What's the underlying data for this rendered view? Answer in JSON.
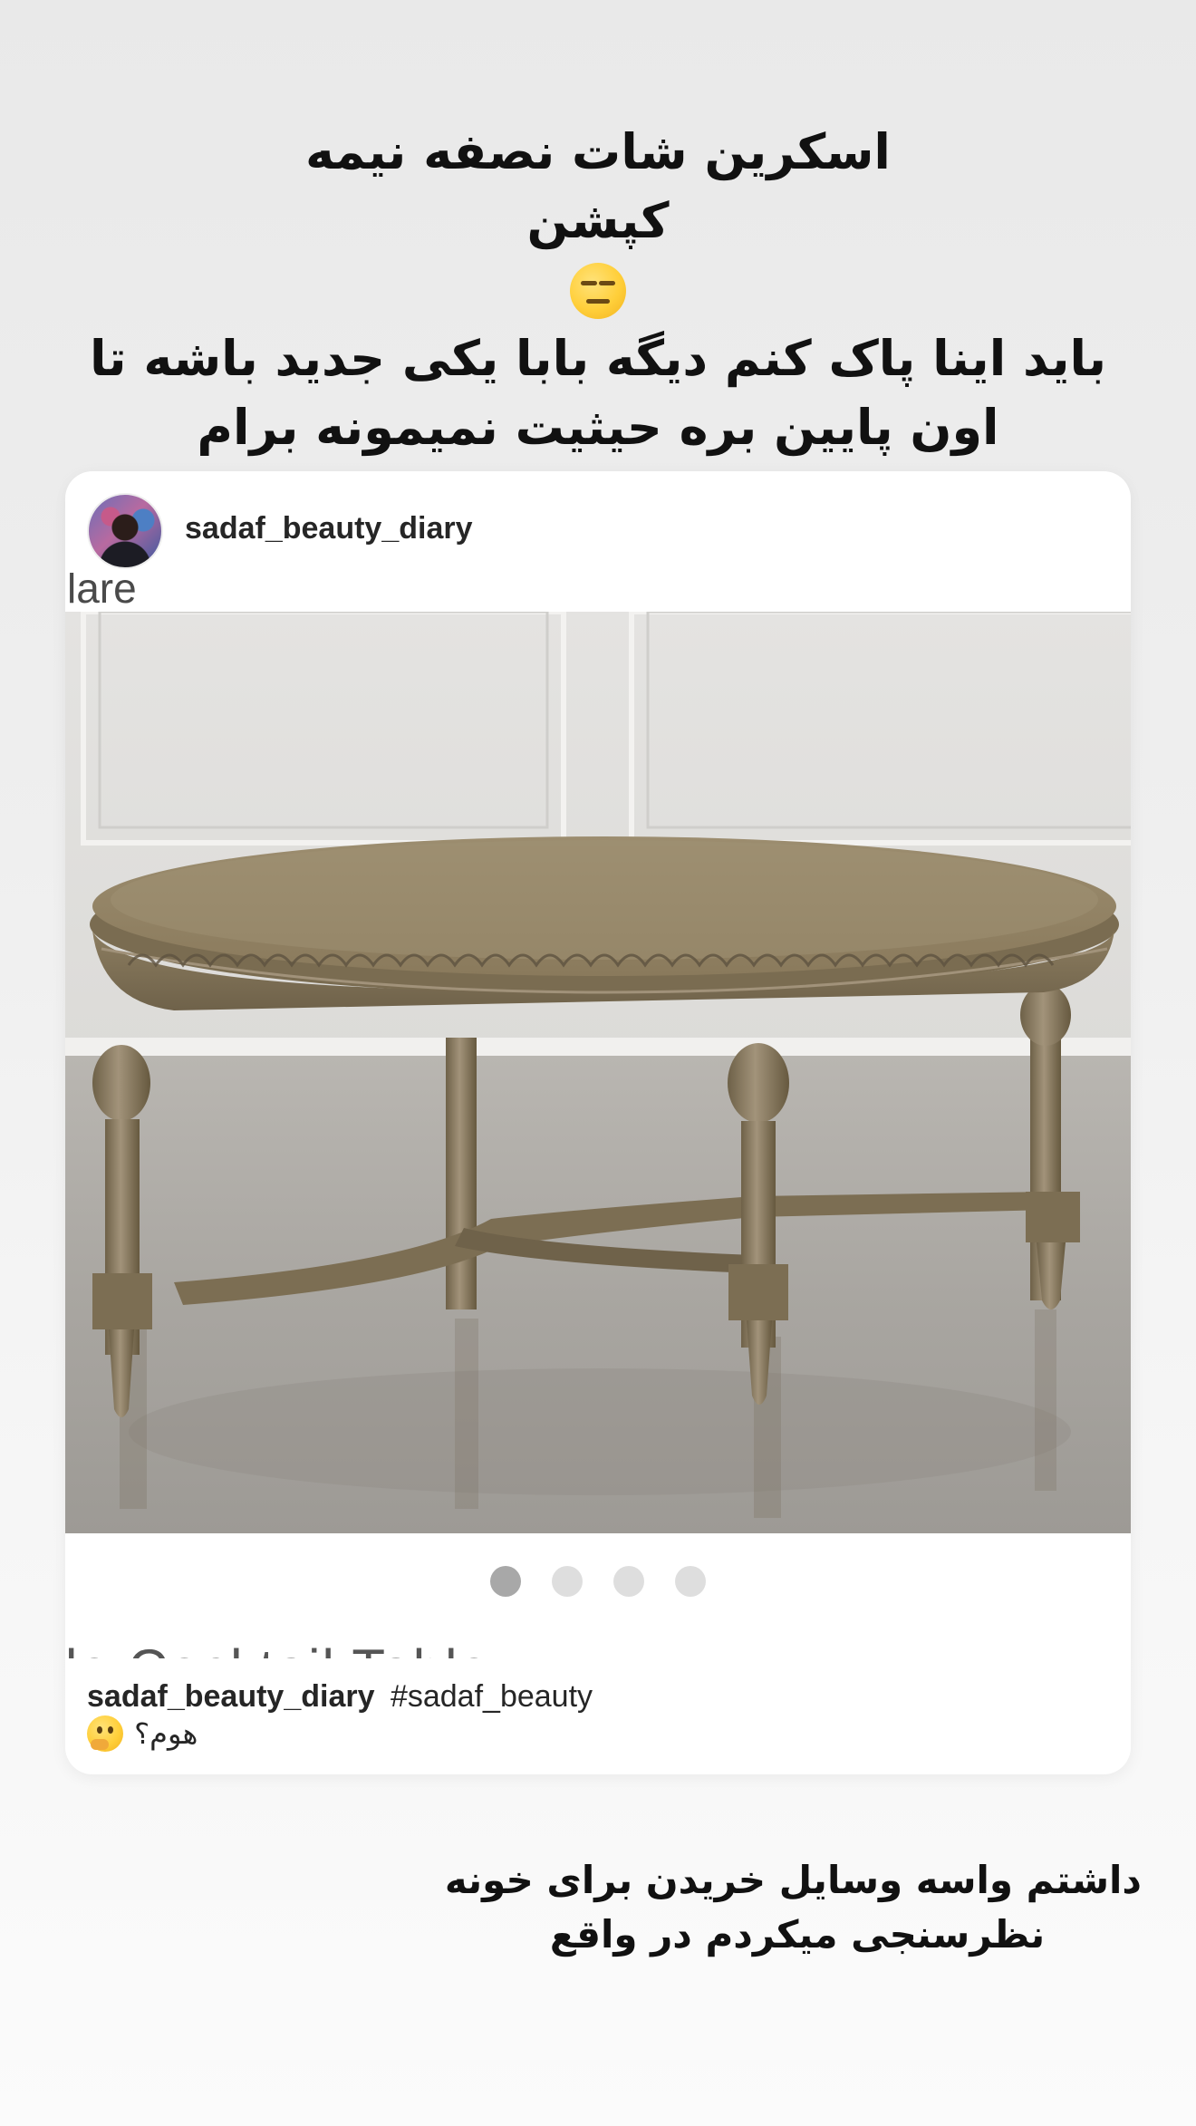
{
  "story": {
    "top_caption": {
      "line1": "اسکرین شات نصفه نیمه",
      "line2": "کپشن",
      "emoji": "expressionless-face",
      "line3": "باید اینا پاک کنم دیگه بابا یکی جدید باشه تا",
      "line4": "اون پایین بره حیثیت نمیمونه برام"
    },
    "bottom_caption": {
      "line1": "داشتم واسه وسایل خریدن برای خونه",
      "line2": "نظرسنجی میکردم در واقع"
    }
  },
  "post": {
    "username": "sadaf_beauty_diary",
    "ghost_text_top": "lare",
    "ghost_text_bottom": "le Cocktail Table",
    "media": {
      "subject": "oval-coffee-table",
      "carousel": {
        "count": 4,
        "active_index": 0
      }
    },
    "caption": {
      "username": "sadaf_beauty_diary",
      "hashtag": "#sadaf_beauty",
      "text": "هوم؟",
      "emoji": "thinking-face"
    }
  },
  "colors": {
    "background": "#ececec",
    "card": "#ffffff",
    "text": "#111111",
    "dot_active": "#a8a8a8",
    "dot_inactive": "#dedede",
    "table_wood": "#8a7b5e"
  }
}
